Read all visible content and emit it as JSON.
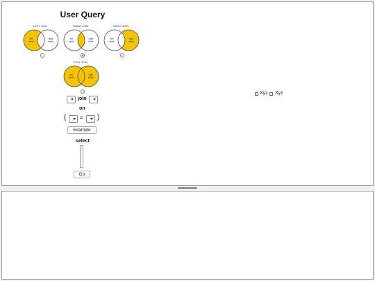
{
  "title": "User Query",
  "joins": {
    "left": {
      "label": "LEFT JOIN",
      "left_text": [
        "left",
        "table"
      ],
      "right_text": [
        "right",
        "table"
      ],
      "selected": false
    },
    "inner": {
      "label": "INNER JOIN",
      "left_text": [
        "left",
        "table"
      ],
      "right_text": [
        "right",
        "table"
      ],
      "selected": true
    },
    "right": {
      "label": "RIGHT JOIN",
      "left_text": [
        "left",
        "table"
      ],
      "right_text": [
        "right",
        "table"
      ],
      "selected": false
    },
    "full": {
      "label": "FULL JOIN",
      "left_text": [
        "left",
        "table"
      ],
      "right_text": [
        "right",
        "table"
      ],
      "selected": false
    }
  },
  "query": {
    "join_label": "join",
    "on_label": "on",
    "open_paren": "(",
    "close_paren": ")",
    "equals": "=",
    "example_button": "Example",
    "select_label": "select",
    "go_button": "Go"
  },
  "checkboxes": [
    {
      "label": "Xyz",
      "checked": false
    },
    {
      "label": "Xyz",
      "checked": false
    }
  ],
  "colors": {
    "highlight": "#f5c400",
    "outline": "#444444",
    "accent": "#2a6ad8"
  }
}
